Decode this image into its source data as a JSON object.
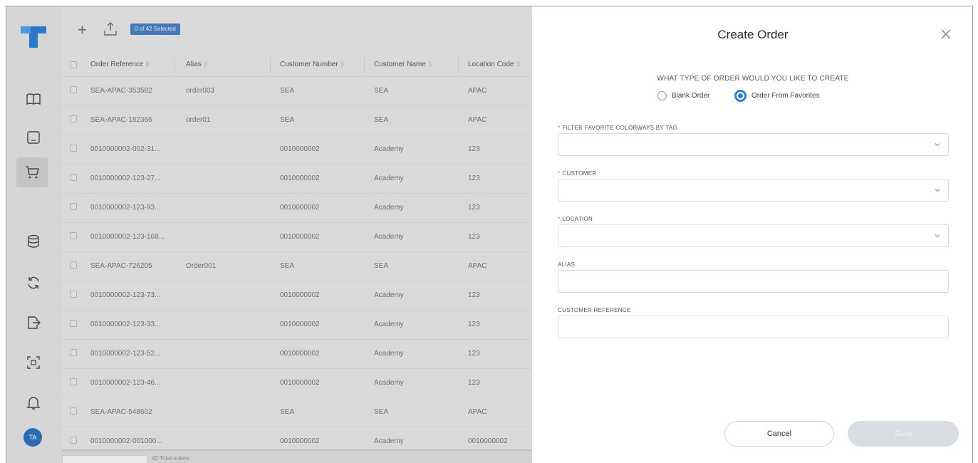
{
  "toolbar": {
    "selection_badge": "0 of 42 Selected"
  },
  "table": {
    "columns": [
      "Order Reference",
      "Alias",
      "Customer Number",
      "Customer Name",
      "Location Code"
    ],
    "rows": [
      [
        "SEA-APAC-353582",
        "order003",
        "SEA",
        "SEA",
        "APAC"
      ],
      [
        "SEA-APAC-182366",
        "order01",
        "SEA",
        "SEA",
        "APAC"
      ],
      [
        "0010000002-002-31...",
        "",
        "0010000002",
        "Academy",
        "123"
      ],
      [
        "0010000002-123-27...",
        "",
        "0010000002",
        "Academy",
        "123"
      ],
      [
        "0010000002-123-93...",
        "",
        "0010000002",
        "Academy",
        "123"
      ],
      [
        "0010000002-123-168...",
        "",
        "0010000002",
        "Academy",
        "123"
      ],
      [
        "SEA-APAC-726205",
        "Order001",
        "SEA",
        "SEA",
        "APAC"
      ],
      [
        "0010000002-123-73...",
        "",
        "0010000002",
        "Academy",
        "123"
      ],
      [
        "0010000002-123-33...",
        "",
        "0010000002",
        "Academy",
        "123"
      ],
      [
        "0010000002-123-52...",
        "",
        "0010000002",
        "Academy",
        "123"
      ],
      [
        "0010000002-123-46...",
        "",
        "0010000002",
        "Academy",
        "123"
      ],
      [
        "SEA-APAC-548602",
        "",
        "SEA",
        "SEA",
        "APAC"
      ],
      [
        "0010000002-001000...",
        "",
        "0010000002",
        "Academy",
        "0010000002"
      ]
    ]
  },
  "footer": {
    "total": "42 Total orders"
  },
  "user": {
    "initials": "TA"
  },
  "modal": {
    "title": "Create Order",
    "question": "WHAT TYPE OF ORDER WOULD YOU LIKE TO CREATE",
    "options": {
      "blank": "Blank Order",
      "favorites": "Order From Favorites"
    },
    "selected_option": "Order From Favorites",
    "fields": {
      "filter_tag": {
        "label": "FILTER FAVORITE COLORWAYS BY TAG",
        "required": true,
        "value": ""
      },
      "customer": {
        "label": "CUSTOMER",
        "required": true,
        "value": ""
      },
      "location": {
        "label": "LOCATION",
        "required": true,
        "value": ""
      },
      "alias": {
        "label": "ALIAS",
        "required": false,
        "value": ""
      },
      "customer_reference": {
        "label": "CUSTOMER REFERENCE",
        "required": false,
        "value": ""
      }
    },
    "required_marker": "*",
    "cancel_label": "Cancel",
    "save_label": "Save"
  },
  "colors": {
    "accent": "#2f7ed8",
    "avatar": "#2a6db5",
    "badge": "#4678b8",
    "required": "#d9534f"
  }
}
